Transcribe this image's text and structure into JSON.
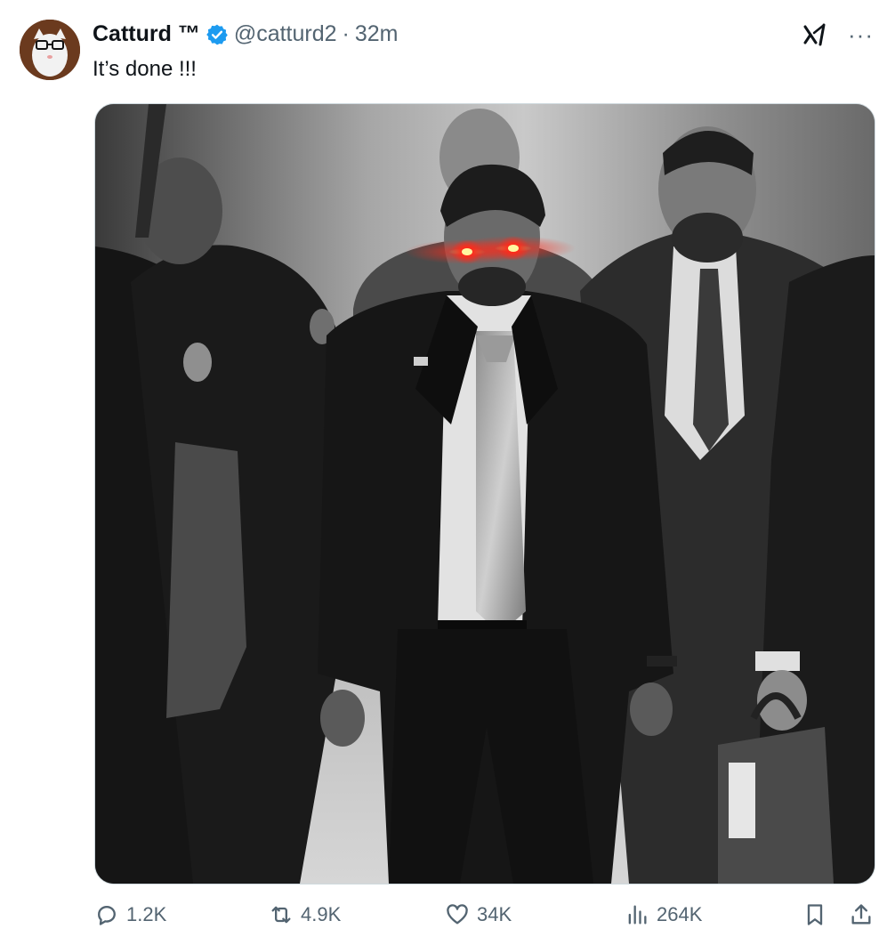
{
  "post": {
    "author_name": "Catturd ™",
    "handle": "@catturd2",
    "separator": "·",
    "time": "32m",
    "text": "It’s done !!!",
    "verified": true
  },
  "icons": {
    "verified": "verified-badge-icon",
    "grok": "grok-icon",
    "more": "more-icon",
    "reply": "reply-icon",
    "repost": "repost-icon",
    "like": "like-icon",
    "views": "views-icon",
    "bookmark": "bookmark-icon",
    "share": "share-icon"
  },
  "more_glyph": "···",
  "actions": {
    "replies": "1.2K",
    "reposts": "4.9K",
    "likes": "34K",
    "views": "264K"
  },
  "colors": {
    "accent": "#1d9bf0",
    "muted": "#536471",
    "text": "#0f1419",
    "eye_glow": "#ff2a1a"
  }
}
